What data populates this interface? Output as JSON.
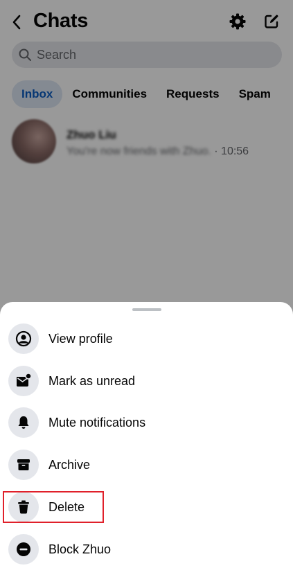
{
  "header": {
    "title": "Chats",
    "back_icon": "chevron-left-icon",
    "settings_icon": "gear-icon",
    "compose_icon": "compose-icon"
  },
  "search": {
    "placeholder": "Search"
  },
  "tabs": [
    {
      "label": "Inbox",
      "active": true
    },
    {
      "label": "Communities",
      "active": false
    },
    {
      "label": "Requests",
      "active": false
    },
    {
      "label": "Spam",
      "active": false
    }
  ],
  "chats": [
    {
      "name": "Zhuo Liu",
      "snippet": "You're now friends with Zhuo.",
      "time": "· 10:56"
    }
  ],
  "sheet": {
    "items": [
      {
        "label": "View profile",
        "icon": "person-circle-icon"
      },
      {
        "label": "Mark as unread",
        "icon": "mail-unread-icon"
      },
      {
        "label": "Mute notifications",
        "icon": "bell-icon"
      },
      {
        "label": "Archive",
        "icon": "archive-box-icon"
      },
      {
        "label": "Delete",
        "icon": "trash-icon",
        "highlighted": true
      },
      {
        "label": "Block Zhuo",
        "icon": "block-icon"
      }
    ]
  },
  "colors": {
    "accent": "#0a5dc2",
    "tab_active_bg": "#dde6f3",
    "highlight_border": "#e0202a",
    "icon_bg": "#e4e6eb"
  }
}
